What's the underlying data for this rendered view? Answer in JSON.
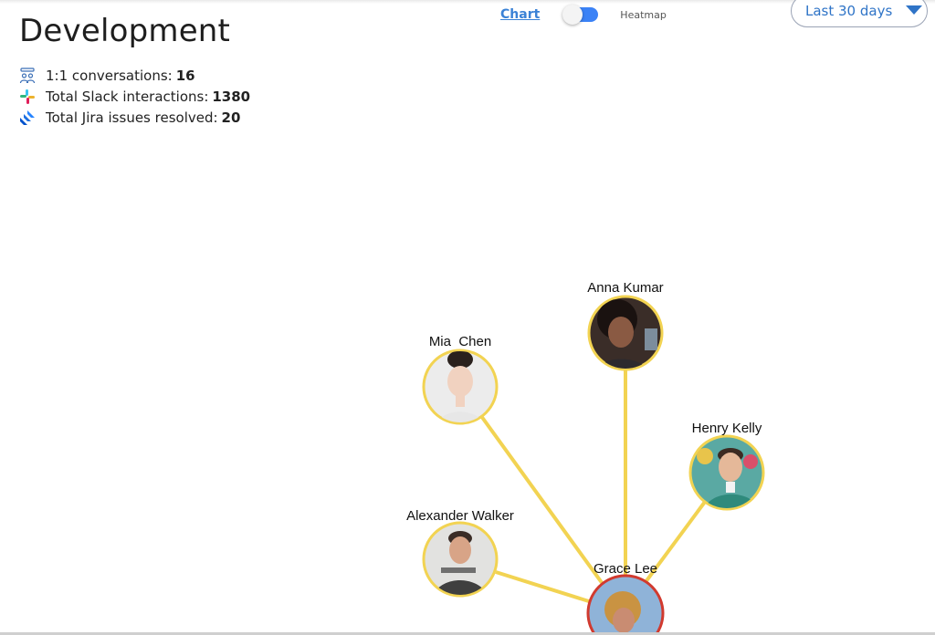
{
  "header": {
    "title": "Development"
  },
  "stats": [
    {
      "icon": "people-icon",
      "label": "1:1 conversations:",
      "value": "16"
    },
    {
      "icon": "slack-icon",
      "label": "Total Slack interactions:",
      "value": "1380"
    },
    {
      "icon": "jira-icon",
      "label": "Total Jira issues resolved:",
      "value": "20"
    }
  ],
  "view_toggle": {
    "chart_label": "Chart",
    "heatmap_label": "Heatmap",
    "active": "Chart"
  },
  "date_range": {
    "selected": "Last 30 days"
  },
  "graph": {
    "center": {
      "name": "Grace Lee"
    },
    "nodes": [
      {
        "name": "Mia  Chen"
      },
      {
        "name": "Anna Kumar"
      },
      {
        "name": "Henry Kelly"
      },
      {
        "name": "Alexander Walker"
      }
    ]
  },
  "colors": {
    "edge": "#f2d352",
    "node_border": "#f2d352",
    "center_border": "#d13a2f",
    "accent": "#3b82f6",
    "link": "#3b82d6"
  }
}
